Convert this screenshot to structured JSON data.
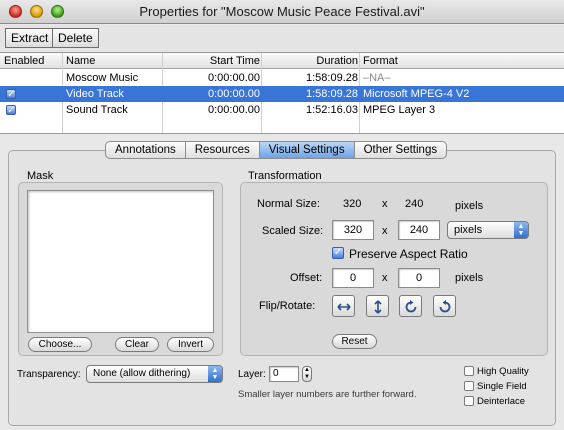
{
  "window": {
    "title": "Properties for \"Moscow Music Peace Festival.avi\""
  },
  "toolbar": {
    "extract_label": "Extract",
    "delete_label": "Delete"
  },
  "table": {
    "headers": {
      "enabled": "Enabled",
      "name": "Name",
      "start_time": "Start Time",
      "duration": "Duration",
      "format": "Format"
    },
    "rows": [
      {
        "enabled": false,
        "name": "Moscow Music",
        "start_time": "0:00:00.00",
        "duration": "1:58:09.28",
        "format": "–NA–",
        "selected": false
      },
      {
        "enabled": true,
        "name": "Video Track",
        "start_time": "0:00:00.00",
        "duration": "1:58:09.28",
        "format": "Microsoft MPEG-4 V2",
        "selected": true
      },
      {
        "enabled": true,
        "name": "Sound Track",
        "start_time": "0:00:00.00",
        "duration": "1:52:16.03",
        "format": "MPEG Layer 3",
        "selected": false
      }
    ]
  },
  "tabs": [
    {
      "label": "Annotations",
      "active": false
    },
    {
      "label": "Resources",
      "active": false
    },
    {
      "label": "Visual Settings",
      "active": true
    },
    {
      "label": "Other Settings",
      "active": false
    }
  ],
  "mask": {
    "title": "Mask",
    "choose_label": "Choose...",
    "clear_label": "Clear",
    "invert_label": "Invert"
  },
  "transformation": {
    "title": "Transformation",
    "normal_size_label": "Normal Size:",
    "normal_width": "320",
    "normal_x": "x",
    "normal_height": "240",
    "normal_unit": "pixels",
    "scaled_size_label": "Scaled Size:",
    "scaled_width": "320",
    "scaled_x": "x",
    "scaled_height": "240",
    "scaled_unit": "pixels",
    "preserve_label": "Preserve Aspect Ratio",
    "preserve_checked": true,
    "offset_label": "Offset:",
    "offset_x": "0",
    "offset_sep": "x",
    "offset_y": "0",
    "offset_unit": "pixels",
    "flip_label": "Flip/Rotate:",
    "reset_label": "Reset"
  },
  "bottom": {
    "transparency_label": "Transparency:",
    "transparency_value": "None (allow dithering)",
    "layer_label": "Layer:",
    "layer_value": "0",
    "layer_hint": "Smaller layer numbers are further forward.",
    "high_quality_label": "High Quality",
    "single_field_label": "Single Field",
    "deinterlace_label": "Deinterlace"
  },
  "colors": {
    "selection": "#3875d7",
    "active_tab": "#6ea3e4"
  }
}
